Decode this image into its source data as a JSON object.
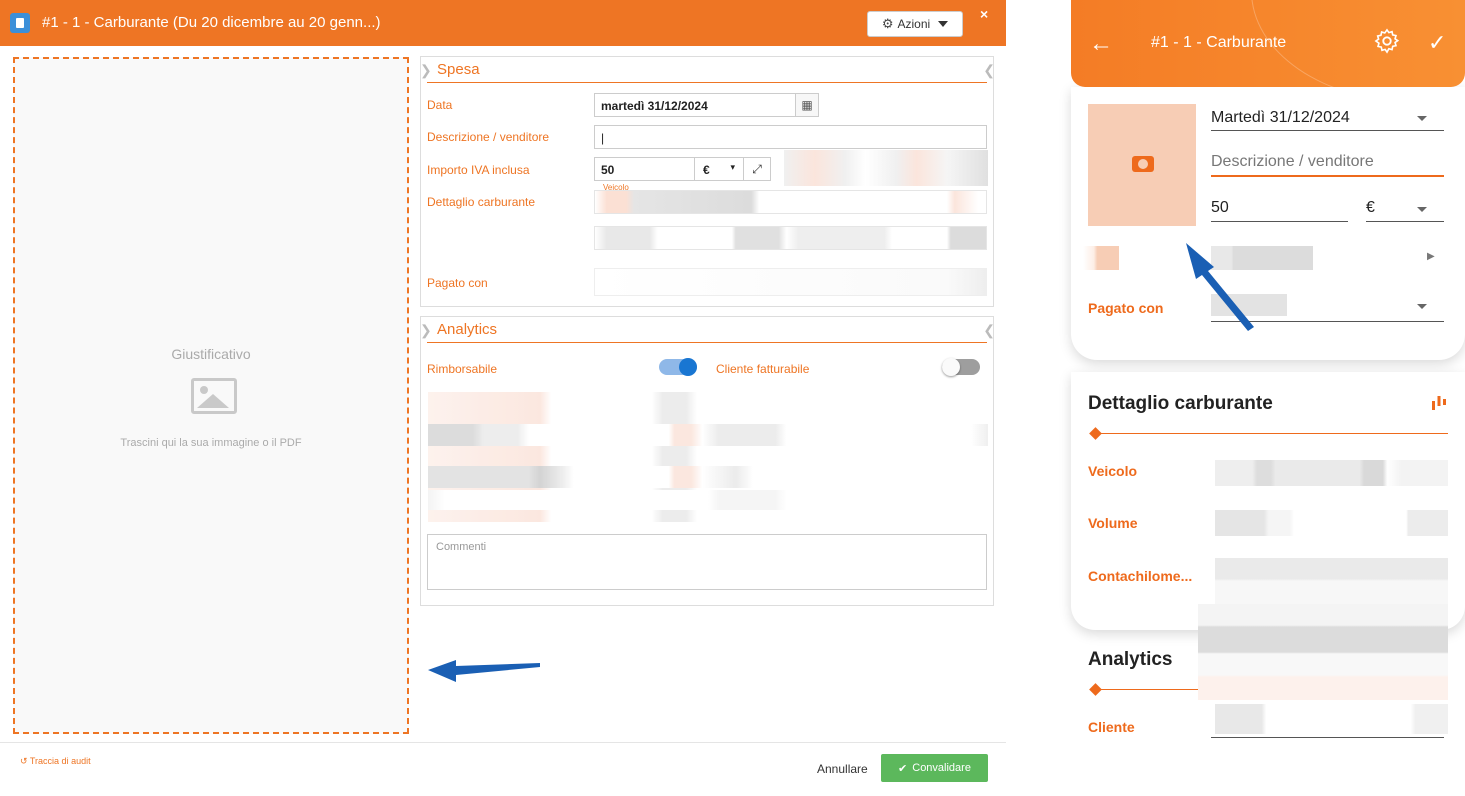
{
  "desktop": {
    "title": "#1 -  1 - Carburante (Du 20 dicembre au 20 genn...)",
    "actions_label": "Azioni",
    "close_label": "×",
    "dropzone": {
      "label": "Giustificativo",
      "hint": "Trascini qui la sua immagine o il PDF"
    },
    "spesa": {
      "title": "Spesa",
      "date_label": "Data",
      "date_value": "martedì 31/12/2024",
      "desc_label": "Descrizione / venditore",
      "desc_value": "",
      "amount_label": "Importo IVA inclusa",
      "amount_value": "50",
      "currency": "€",
      "fuel_label": "Dettaglio carburante",
      "vehicle_label": "Veicolo",
      "paid_label": "Pagato con"
    },
    "analytics": {
      "title": "Analytics",
      "refundable_label": "Rimborsabile",
      "refundable_on": true,
      "billable_label": "Cliente fatturabile",
      "billable_on": false,
      "comments_placeholder": "Commenti"
    },
    "footer": {
      "audit_label": "Traccia di audit",
      "cancel_label": "Annullare",
      "validate_label": "Convalidare"
    }
  },
  "mobile": {
    "title": "#1 - 1 - Carburante",
    "date_value": "Martedì 31/12/2024",
    "desc_placeholder": "Descrizione / venditore",
    "amount_value": "50",
    "currency": "€",
    "paid_label": "Pagato con",
    "fuel_section_title": "Dettaglio carburante",
    "vehicle_label": "Veicolo",
    "volume_label": "Volume",
    "odometer_label": "Contachilome...",
    "analytics_title": "Analytics",
    "client_label": "Cliente"
  },
  "colors": {
    "brand_orange": "#ee7524",
    "validate_green": "#5cb85c",
    "toggle_blue": "#1976d2",
    "arrow_blue": "#1a5fb4"
  }
}
